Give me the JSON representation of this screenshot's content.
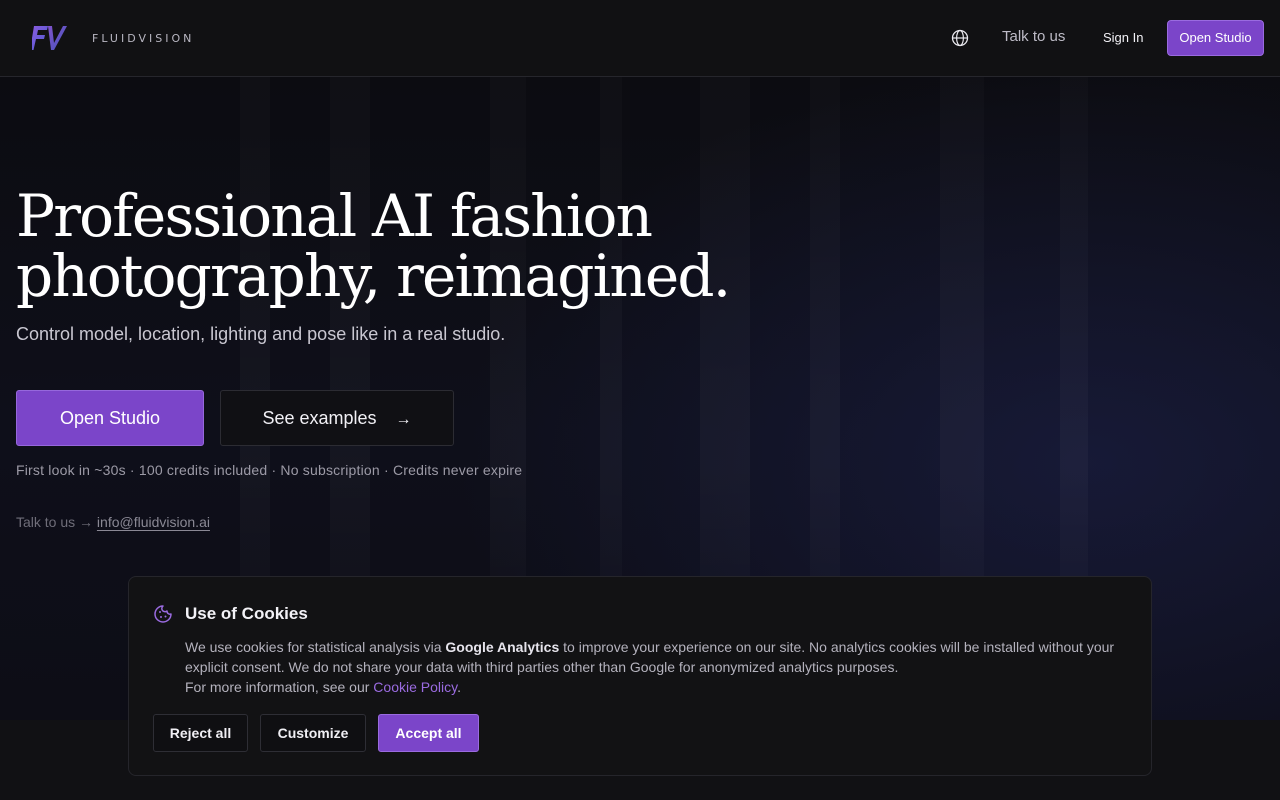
{
  "header": {
    "logo_text": "FLUIDVISION",
    "talk_label": "Talk to us",
    "signin_label": "Sign In",
    "open_studio_label": "Open Studio",
    "language_icon": "globe-icon"
  },
  "hero": {
    "headline_line1": "Professional AI fashion",
    "headline_line2": "photography, reimagined.",
    "subline": "Control model, location, lighting and pose like in a real studio.",
    "primary_cta": "Open Studio",
    "secondary_cta": "See examples",
    "secondary_icon": "arrow-right-icon",
    "perks": "First look in ~30s · 100 credits included · No subscription · Credits never expire",
    "contact_prefix": "Talk to us →",
    "contact_email": "info@fluidvision.ai"
  },
  "cookie_banner": {
    "icon": "cookie-icon",
    "title": "Use of Cookies",
    "body_part1": "We use cookies for statistical analysis via ",
    "body_bold": "Google Analytics",
    "body_part2": " to improve your experience on our site. No analytics cookies will be installed without your explicit consent. We do not share your data with third parties other than Google for anonymized analytics purposes.",
    "body_part3": "For more information, see our ",
    "policy_link": "Cookie Policy",
    "body_end": ".",
    "reject_label": "Reject all",
    "customize_label": "Customize",
    "accept_label": "Accept all"
  },
  "colors": {
    "accent": "#7b45c9",
    "accent_border": "#9a6be0",
    "background": "#0b0b0f",
    "header_bg": "#111113"
  }
}
